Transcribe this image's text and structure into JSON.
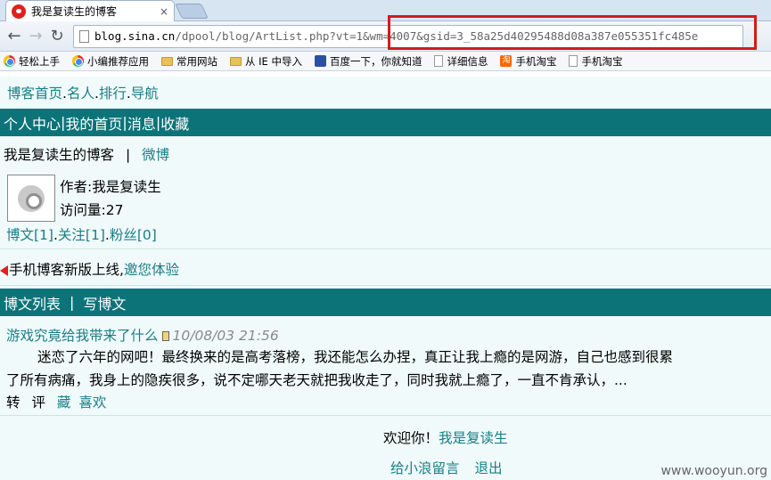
{
  "browser": {
    "tab_title": "我是复读生的博客",
    "tab_close": "×",
    "url_host": "blog.sina.cn",
    "url_path": "/dpool/blog/ArtList.php?vt=1&wm=4007&gsid=3_58a25d40295488d08a387e055351fc485e",
    "bookmarks": [
      {
        "label": "轻松上手",
        "icon": "chrome-icon"
      },
      {
        "label": "小编推荐应用",
        "icon": "chrome-icon"
      },
      {
        "label": "常用网站",
        "icon": "folder-icon"
      },
      {
        "label": "从 IE 中导入",
        "icon": "folder-icon"
      },
      {
        "label": "百度一下，你就知道",
        "icon": "baidu-paw-icon"
      },
      {
        "label": "详细信息",
        "icon": "page-icon"
      },
      {
        "label": "手机淘宝",
        "icon": "taobao-icon"
      },
      {
        "label": "手机淘宝",
        "icon": "page-icon"
      }
    ]
  },
  "page": {
    "top_nav": [
      "博客首页",
      "名人",
      "排行",
      "导航"
    ],
    "user_bar": [
      "个人中心",
      "我的首页",
      "消息",
      "收藏"
    ],
    "blog_name": "我是复读生的博客",
    "weibo_link": "微博",
    "author": "作者:我是复读生",
    "visits": "访问量:27",
    "stats": [
      "博文[1]",
      "关注[1]",
      "粉丝[0]"
    ],
    "notice_text": "手机博客新版上线,",
    "notice_link": "邀您体验",
    "list_bar": {
      "list": "博文列表",
      "write": "写博文"
    },
    "post": {
      "title": "游戏究竟给我带来了什么",
      "date": "10/08/03 21:56",
      "line1": "迷恋了六年的网吧！最终换来的是高考落榜，我还能怎么办捏，真正让我上瘾的是网游，自己也感到很累",
      "line2": "了所有病痛，我身上的隐疾很多，说不定哪天老天就把我收走了，同时我就上瘾了，一直不肯承认，...",
      "action_forward": "转",
      "action_comment": "评",
      "action_fav": "藏",
      "action_like": "喜欢"
    },
    "welcome_text": "欢迎你！",
    "welcome_user": "我是复读生",
    "leave_msg": "给小浪留言",
    "logout": "退出"
  },
  "watermark": "www.wooyun.org"
}
